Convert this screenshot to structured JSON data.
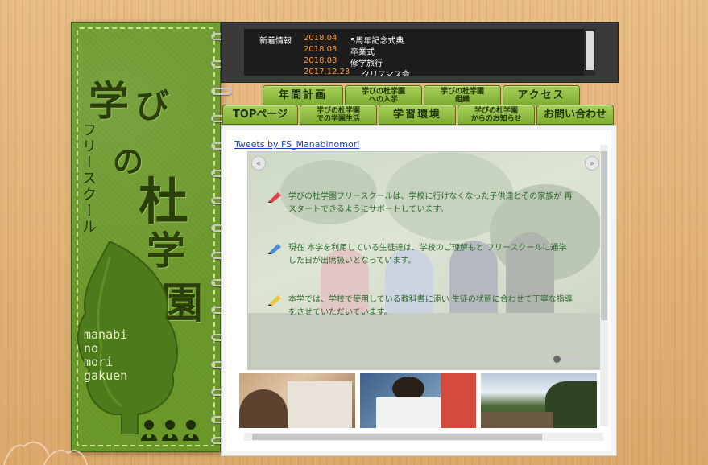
{
  "site": {
    "title_chars": [
      "学",
      "び",
      "の",
      "杜",
      "学",
      "園"
    ],
    "subtitle": "フリースクール",
    "romaji_lines": [
      "manabi",
      "no",
      "mori",
      "gakuen"
    ]
  },
  "news": {
    "label": "新着情報",
    "items": [
      {
        "date": "2018.04",
        "text": "5周年記念式典"
      },
      {
        "date": "2018.03",
        "text": "卒業式"
      },
      {
        "date": "2018.03",
        "text": "修学旅行"
      },
      {
        "date": "2017.12.23",
        "text": "クリスマス会"
      }
    ]
  },
  "tabs_row1": [
    {
      "label": "年間計画",
      "style": "big"
    },
    {
      "label": "学びの杜学園",
      "label2": "への入学",
      "style": "small"
    },
    {
      "label": "学びの杜学園",
      "label2": "組織",
      "style": "small"
    },
    {
      "label": "アクセス",
      "style": "big"
    }
  ],
  "tabs_row2": [
    {
      "label": "TOPページ",
      "style": "big"
    },
    {
      "label": "学びの杜学園",
      "label2": "での学園生活",
      "style": "small"
    },
    {
      "label": "学習環境",
      "style": "big"
    },
    {
      "label": "学びの杜学園",
      "label2": "からのお知らせ",
      "style": "small"
    },
    {
      "label": "お問い合わせ",
      "style": "big"
    }
  ],
  "content": {
    "tweets_link": "Tweets by FS_Manabinomori",
    "prev_arrow": "«",
    "next_arrow": "»",
    "bullets": [
      {
        "text": "学びの杜学園フリースクールは、学校に行けなくなった子供達とその家族が 再スタートできるようにサポートしています。",
        "color": "#e0434a"
      },
      {
        "text": "現在 本学を利用している生徒達は、学校のご理解もと フリースクールに通学した日が出席扱いとなっています。",
        "color": "#4a8ed8"
      },
      {
        "text": "本学では、学校で使用している教科書に添い 生徒の状態に合わせて丁寧な指導をさせていただいています。",
        "color": "#e8c63a"
      }
    ],
    "slide_dots": 3,
    "active_dot": 0
  },
  "colors": {
    "cover_green": "#6c9a2a",
    "tab_green": "#8fbd42",
    "news_date": "#ff9a2e",
    "bullet_text": "#2e6a2e"
  }
}
